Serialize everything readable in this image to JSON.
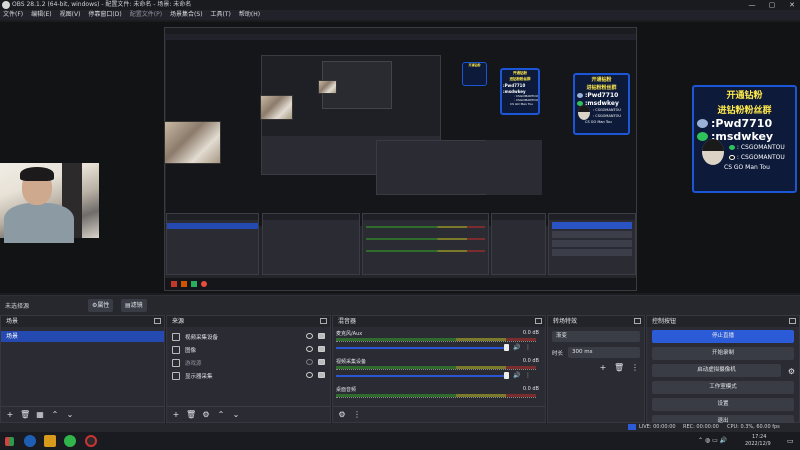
{
  "window": {
    "title": "OBS 28.1.2 (64-bit, windows) - 配置文件: 未命名 - 场景: 未命名",
    "min": "—",
    "max": "▢",
    "close": "✕"
  },
  "menu": [
    "文件(F)",
    "编辑(E)",
    "视图(V)",
    "停靠窗口(D)",
    "配置文件(P)",
    "场景集合(S)",
    "工具(T)",
    "帮助(H)"
  ],
  "promo": {
    "title_line1": "开通钻粉",
    "title_line2": "进钻粉粉丝群",
    "wechat_id": ":Pwd7710",
    "wechat_id2": ":msdwkey",
    "social1": ": CSGOMANTOU",
    "social2": ": CSGOMANTOU",
    "signature": "CS GO Man Tou"
  },
  "source_bar": {
    "no_source": "未选择源",
    "properties": "⚙属性",
    "filters": "▤滤镜"
  },
  "scenes": {
    "header": "场景",
    "items": [
      "场景"
    ]
  },
  "sources": {
    "header": "来源",
    "items": [
      "视频采集设备",
      "图像",
      "游戏源",
      "显示器采集"
    ]
  },
  "mixer": {
    "header": "混音器",
    "channels": [
      {
        "name": "麦克风/Aux",
        "db": "0.0 dB"
      },
      {
        "name": "视频采集设备",
        "db": "0.0 dB"
      },
      {
        "name": "桌面音频",
        "db": "0.0 dB"
      }
    ]
  },
  "transitions": {
    "header": "转场特效",
    "type": "渐变",
    "duration_label": "时长",
    "duration": "300 ms"
  },
  "controls": {
    "header": "控制按钮",
    "buttons": [
      "停止直播",
      "开始录制",
      "启动虚拟摄像机",
      "工作室模式",
      "设置",
      "退出"
    ]
  },
  "status": {
    "live": "LIVE: 00:00:00",
    "rec": "REC: 00:00:00",
    "cpu": "CPU: 0.3%, 60.00 fps"
  },
  "taskbar": {
    "time": "17:24",
    "date": "2022/12/9"
  },
  "colors": {
    "accent": "#2b5bd7",
    "promo_border": "#1a56d6",
    "promo_title": "#ffe94a"
  }
}
